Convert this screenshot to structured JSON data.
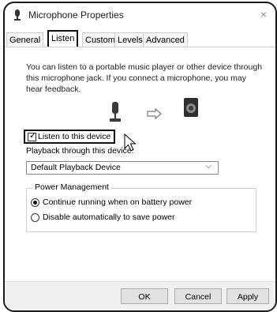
{
  "window": {
    "title": "Microphone Properties",
    "close_glyph": "×",
    "icon": "microphone-icon"
  },
  "tabs": [
    {
      "label": "General",
      "active": false
    },
    {
      "label": "Listen",
      "active": true
    },
    {
      "label": "Custom",
      "active": false
    },
    {
      "label": "Levels",
      "active": false
    },
    {
      "label": "Advanced",
      "active": false
    }
  ],
  "listen": {
    "description": "You can listen to a portable music player or other device through this microphone jack. If you connect a microphone, you may hear feedback.",
    "listen_checkbox_label": "Listen to this device",
    "listen_checked": true,
    "playback_label": "Playback through this device:",
    "playback_device": "Default Playback Device",
    "power": {
      "title": "Power Management",
      "option_continue": "Continue running when on battery power",
      "option_disable": "Disable automatically to save power",
      "selected": "continue"
    }
  },
  "footer": {
    "ok": "OK",
    "cancel": "Cancel",
    "apply": "Apply"
  },
  "icons": [
    "microphone-icon",
    "arrow-right-icon",
    "speaker-icon",
    "mouse-cursor-icon",
    "chevron-down-icon"
  ]
}
